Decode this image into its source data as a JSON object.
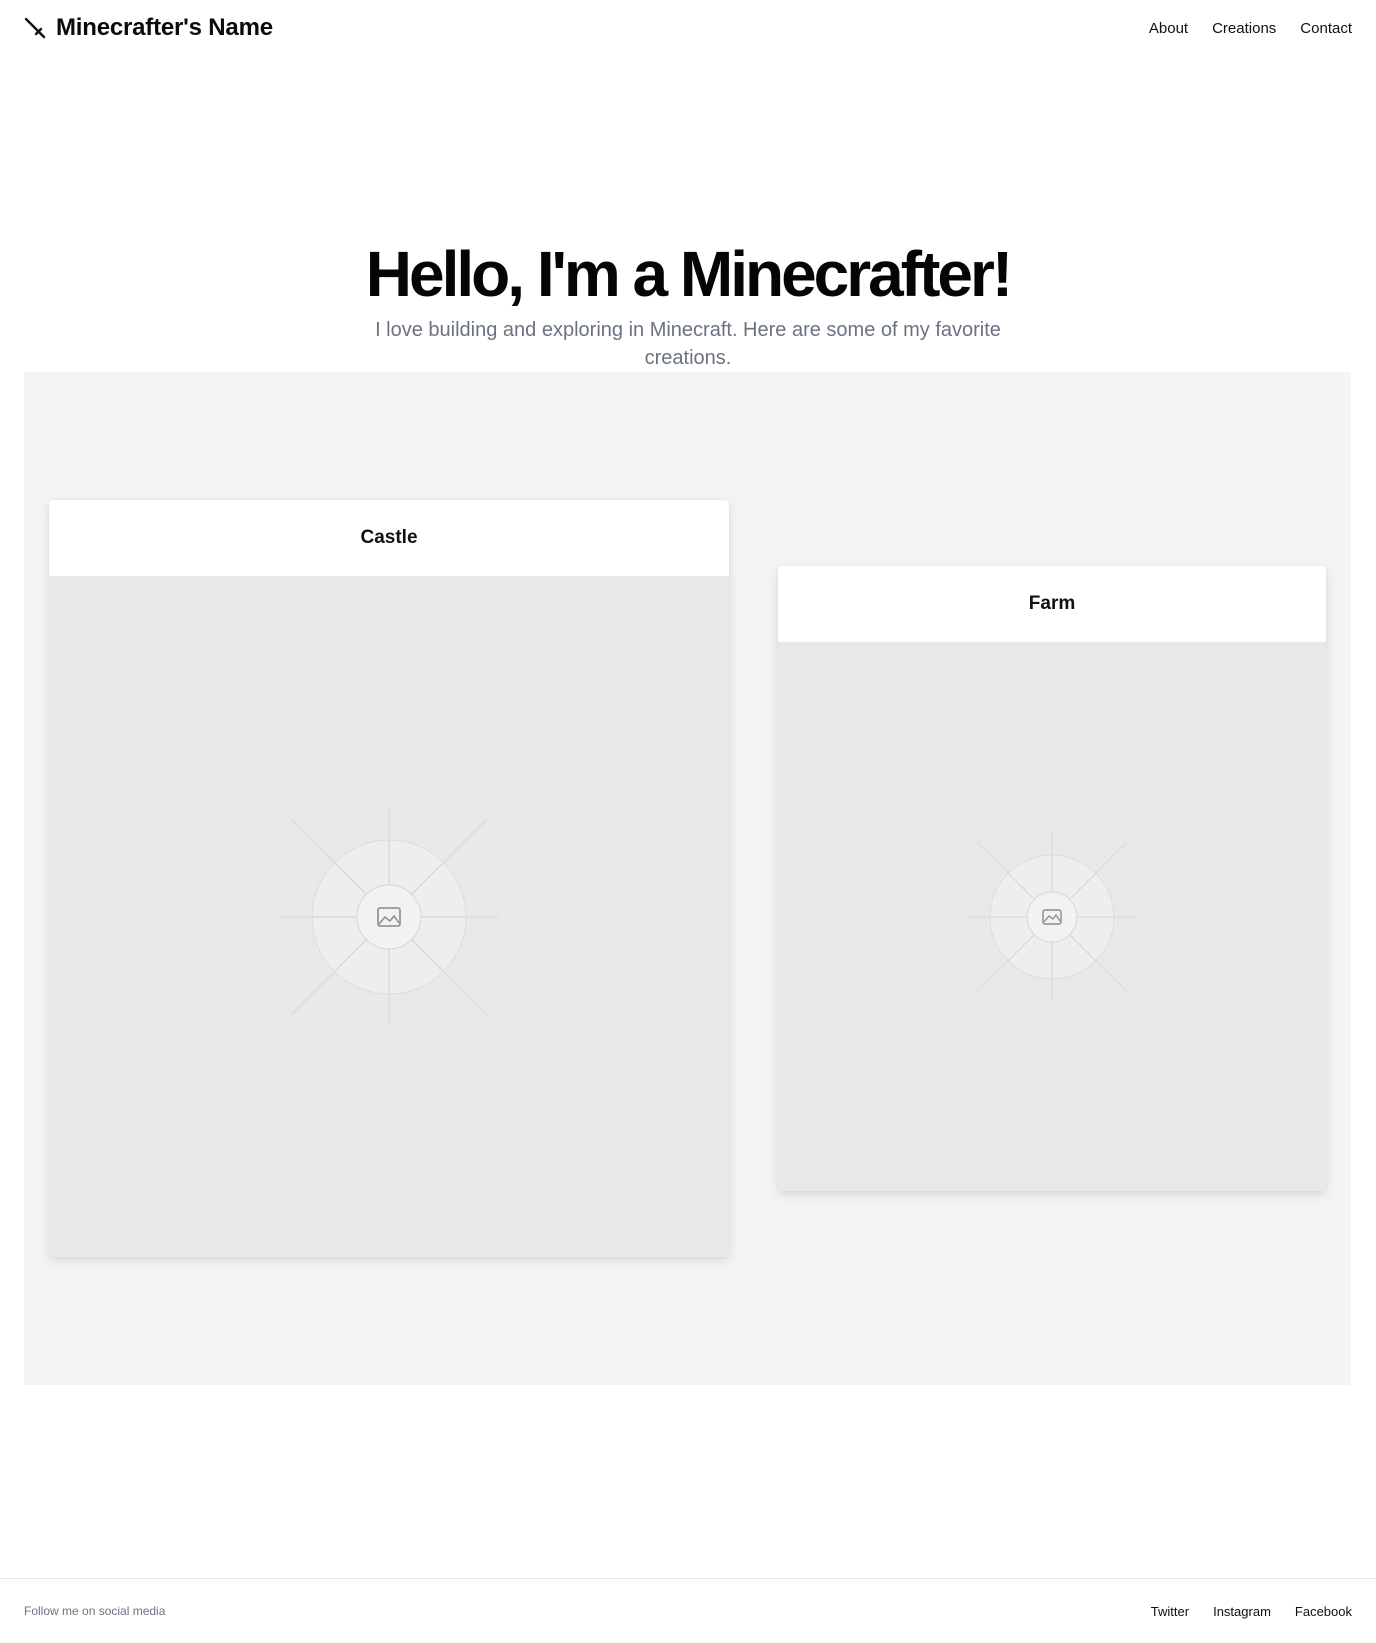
{
  "header": {
    "brand_icon": "sword-icon",
    "brand_name": "Minecrafter's Name",
    "nav": [
      {
        "label": "About"
      },
      {
        "label": "Creations"
      },
      {
        "label": "Contact"
      }
    ]
  },
  "hero": {
    "title": "Hello, I'm a Minecrafter!",
    "subtitle": "I love building and exploring in Minecraft. Here are some of my favorite creations."
  },
  "gallery": {
    "cards": [
      {
        "title": "Castle",
        "image_icon": "image-placeholder-icon"
      },
      {
        "title": "Farm",
        "image_icon": "image-placeholder-icon"
      }
    ]
  },
  "footer": {
    "note": "Follow me on social media",
    "links": [
      {
        "label": "Twitter"
      },
      {
        "label": "Instagram"
      },
      {
        "label": "Facebook"
      }
    ]
  },
  "colors": {
    "subtitle": "#6b7280",
    "gallery_bg": "#f3f4f6",
    "image_placeholder": "#e8e8e8"
  }
}
